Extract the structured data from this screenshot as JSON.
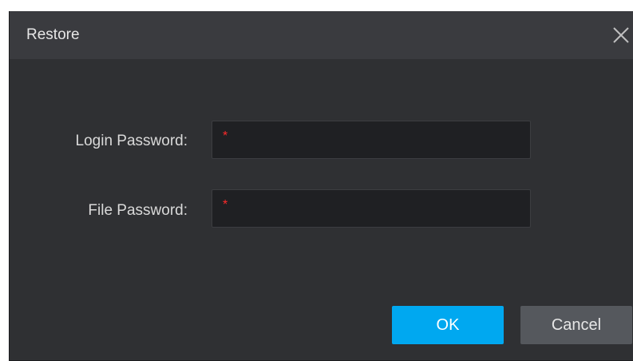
{
  "dialog": {
    "title": "Restore",
    "close_icon": "close-icon"
  },
  "form": {
    "login_password": {
      "label": "Login Password:",
      "value": "",
      "required_marker": "*"
    },
    "file_password": {
      "label": "File Password:",
      "value": "",
      "required_marker": "*"
    }
  },
  "buttons": {
    "ok_label": "OK",
    "cancel_label": "Cancel"
  },
  "colors": {
    "dialog_bg": "#2f3033",
    "titlebar_bg": "#3a3b3f",
    "field_bg": "#1f2023",
    "required_marker": "#ff2a2a",
    "ok_button": "#00a8f0",
    "cancel_button": "#55585d"
  }
}
